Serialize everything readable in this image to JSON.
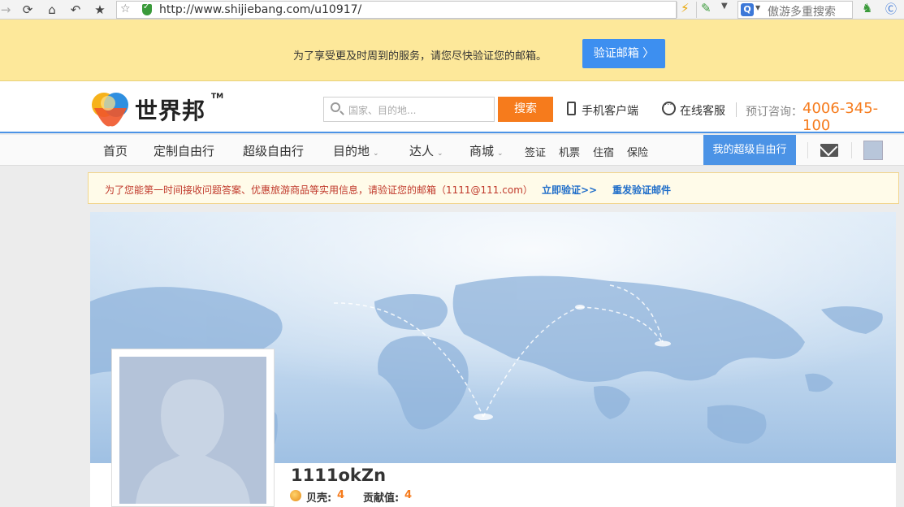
{
  "browser": {
    "url": "http://www.shijiebang.com/u10917/",
    "search_engine_placeholder": "傲游多重搜索"
  },
  "verify_banner": {
    "text": "为了享受更及时周到的服务，请您尽快验证您的邮箱。",
    "button_label": "验证邮箱 〉"
  },
  "header": {
    "logo_text": "世界邦",
    "logo_tm": "TM",
    "search_placeholder": "国家、目的地...",
    "search_button": "搜索",
    "mobile_client": "手机客户端",
    "online_service": "在线客服",
    "booking_label": "预订咨询：",
    "booking_phone": "4006-345-100"
  },
  "nav": {
    "items": [
      {
        "label": "首页"
      },
      {
        "label": "定制自由行"
      },
      {
        "label": "超级自由行"
      },
      {
        "label": "目的地"
      },
      {
        "label": "达人"
      },
      {
        "label": "商城"
      },
      {
        "label": "签证"
      },
      {
        "label": "机票"
      },
      {
        "label": "住宿"
      },
      {
        "label": "保险"
      }
    ],
    "primary": "我的超级自由行"
  },
  "notice": {
    "text": "为了您能第一时间接收问题答案、优惠旅游商品等实用信息，请验证您的邮箱（1111@111.com）",
    "link_verify": "立即验证>>",
    "link_resend": "重发验证邮件"
  },
  "profile": {
    "username": "1111okZn",
    "shell_label": "贝壳:",
    "shell_value": "4",
    "contribution_label": "贡献值:",
    "contribution_value": "4"
  },
  "colors": {
    "accent_orange": "#f67b1c",
    "accent_blue": "#4b93e6",
    "banner_yellow": "#fde89a"
  }
}
